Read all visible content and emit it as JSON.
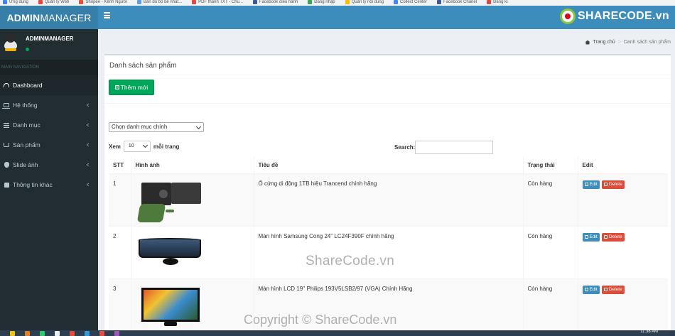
{
  "bookmarks": [
    "Ứng dụng",
    "Quản lý Web",
    "Shopee - Kênh Người",
    "Bán đồ bộ bé nhất...",
    "PDF thành TXT - Chu...",
    "Facebook điều hành",
    "Đăng nhập",
    "Quản lý nội dung",
    "Collect Center",
    "Facebook Chanel",
    "Đăng kí"
  ],
  "header": {
    "logo_bold": "ADMIN",
    "logo_rest": "MANAGER",
    "brand_badge": "SHARECODE.vn"
  },
  "user": {
    "name": "ADMINMANAGER"
  },
  "sidebar": {
    "nav_header": "MAIN NAVIGATION",
    "items": [
      {
        "label": "Dashboard",
        "icon": "dashboard-icon"
      },
      {
        "label": "Hệ thống",
        "icon": "laptop-icon"
      },
      {
        "label": "Danh mục",
        "icon": "list-icon"
      },
      {
        "label": "Sản phẩm",
        "icon": "cart-icon"
      },
      {
        "label": "Slide ảnh",
        "icon": "apple-icon"
      },
      {
        "label": "Thông tin khác",
        "icon": "rss-icon"
      }
    ]
  },
  "breadcrumb": {
    "home": "Trang chủ",
    "current": "Danh sách sản phẩm"
  },
  "box": {
    "title": "Danh sách sản phẩm",
    "add_button": "Thêm mới",
    "category_select": "Chọn danh mục chính",
    "show_prefix": "Xem",
    "page_length": "10",
    "show_suffix": "mỗi trang",
    "search_label": "Search:"
  },
  "table": {
    "headers": [
      "STT",
      "Hình ảnh",
      "Tiêu đề",
      "Trạng thái",
      "Edit"
    ],
    "rows": [
      {
        "stt": "1",
        "title": "Ổ cứng di động 1TB hiệu Trancend chính hãng",
        "status": "Còn hàng",
        "edit": "Edit",
        "delete": "Delete"
      },
      {
        "stt": "2",
        "title": "Màn hình Samsung Cong 24\" LC24F390F chính hãng",
        "status": "Còn hàng",
        "edit": "Edit",
        "delete": "Delete"
      },
      {
        "stt": "3",
        "title": "Màn hình LCD 19'' Philips 193V5LSB2/97 (VGA) Chính Hãng",
        "status": "Còn hàng",
        "edit": "Edit",
        "delete": "Delete"
      }
    ]
  },
  "watermark": "ShareCode.vn",
  "copyright": "Copyright © ShareCode.vn",
  "taskbar": {
    "clock": "11:38 AM"
  },
  "colors": {
    "header": "#3c8dbc",
    "logo_bg": "#367fa9",
    "sidebar": "#222d32",
    "success": "#00a65a",
    "danger": "#dd4b39"
  }
}
